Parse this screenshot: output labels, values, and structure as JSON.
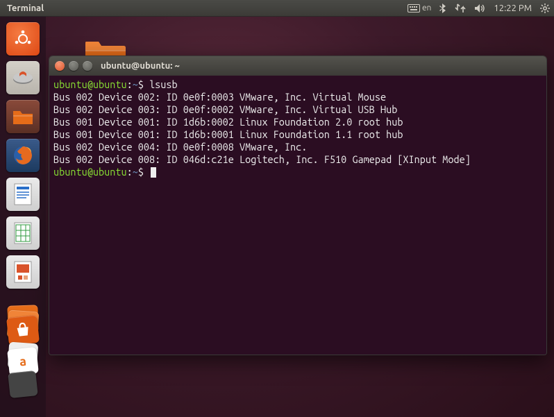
{
  "topbar": {
    "app_title": "Terminal",
    "lang": "en",
    "clock": "12:22 PM"
  },
  "launcher": {
    "items": [
      {
        "name": "ubuntu-dash"
      },
      {
        "name": "ubiquity-installer"
      },
      {
        "name": "nautilus-files"
      },
      {
        "name": "firefox"
      },
      {
        "name": "libreoffice-writer"
      },
      {
        "name": "libreoffice-calc"
      },
      {
        "name": "libreoffice-impress"
      }
    ]
  },
  "terminal": {
    "window_title": "ubuntu@ubuntu: ~",
    "prompt_user": "ubuntu@ubuntu",
    "prompt_path": "~",
    "prompt_symbol": "$",
    "command": "lsusb",
    "output": [
      "Bus 002 Device 002: ID 0e0f:0003 VMware, Inc. Virtual Mouse",
      "Bus 002 Device 003: ID 0e0f:0002 VMware, Inc. Virtual USB Hub",
      "Bus 001 Device 001: ID 1d6b:0002 Linux Foundation 2.0 root hub",
      "Bus 001 Device 001: ID 1d6b:0001 Linux Foundation 1.1 root hub",
      "Bus 002 Device 004: ID 0e0f:0008 VMware, Inc.",
      "Bus 002 Device 008: ID 046d:c21e Logitech, Inc. F510 Gamepad [XInput Mode]"
    ]
  }
}
